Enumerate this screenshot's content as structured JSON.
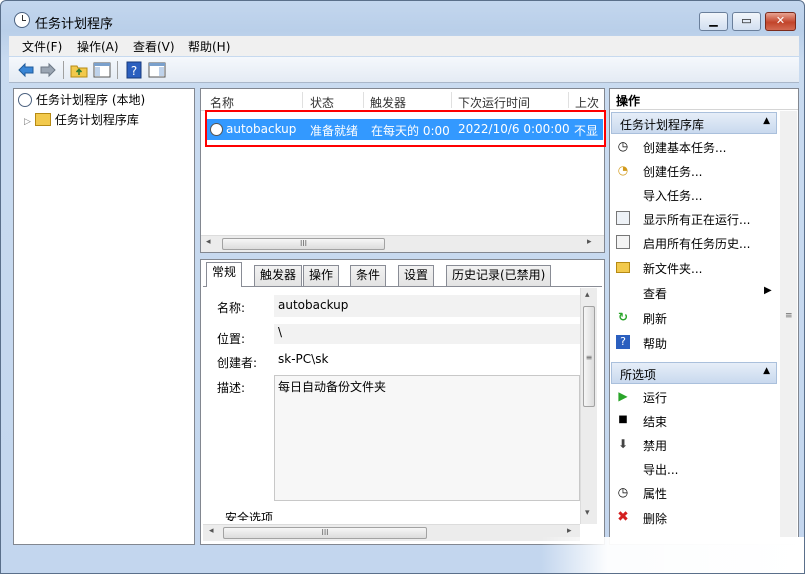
{
  "window": {
    "title": "任务计划程序"
  },
  "menu": [
    "文件(F)",
    "操作(A)",
    "查看(V)",
    "帮助(H)"
  ],
  "tree": {
    "root": "任务计划程序 (本地)",
    "child": "任务计划程序库"
  },
  "list": {
    "columns": [
      "名称",
      "状态",
      "触发器",
      "下次运行时间",
      "上次"
    ],
    "selected_row": {
      "name": "autobackup",
      "status": "准备就绪",
      "trigger": "在每天的 0:00",
      "next_run": "2022/10/6 0:00:00",
      "last": "不显"
    }
  },
  "detail": {
    "tabs": [
      "常规",
      "触发器",
      "操作",
      "条件",
      "设置",
      "历史记录(已禁用)"
    ],
    "labels": {
      "name": "名称:",
      "location": "位置:",
      "author": "创建者:",
      "description": "描述:",
      "security": "安全选项"
    },
    "values": {
      "name": "autobackup",
      "location": "\\",
      "author": "sk-PC\\sk",
      "description": "每日自动备份文件夹"
    }
  },
  "actions": {
    "title": "操作",
    "group1": "任务计划程序库",
    "group1_items": [
      "创建基本任务...",
      "创建任务...",
      "导入任务...",
      "显示所有正在运行...",
      "启用所有任务历史...",
      "新文件夹...",
      "查看",
      "刷新",
      "帮助"
    ],
    "group2": "所选项",
    "group2_items": [
      "运行",
      "结束",
      "禁用",
      "导出...",
      "属性",
      "删除"
    ]
  },
  "scroll_glyph": "III",
  "vscroll_glyph": "≡",
  "colors": {
    "selection": "#3399ff",
    "highlight_box": "#ff0000",
    "delete_icon": "#d42020",
    "run_icon": "#2aa52a",
    "help_icon": "#2b5fbf"
  }
}
